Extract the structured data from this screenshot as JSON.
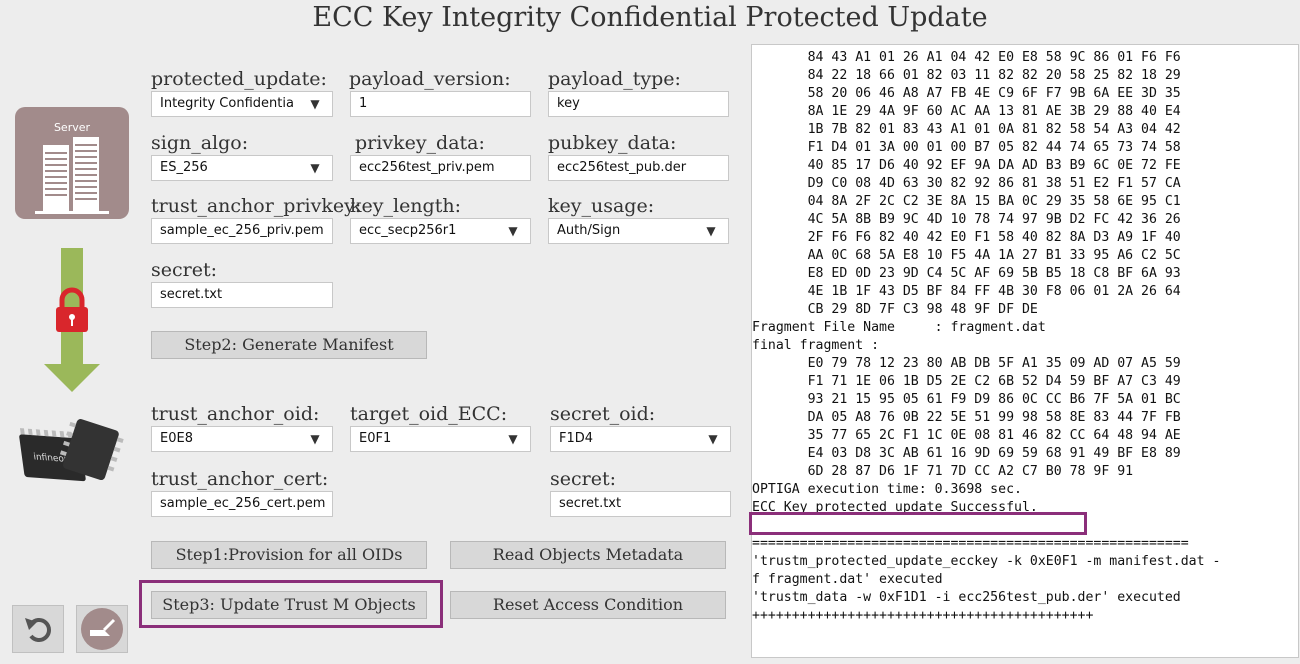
{
  "title": "ECC Key Integrity Confidential Protected Update",
  "server_label": "Server",
  "chip_brand": "infineon",
  "form": {
    "protected_update": {
      "label": "protected_update:",
      "value": "Integrity Confidentia"
    },
    "payload_version": {
      "label": "payload_version:",
      "value": "1"
    },
    "payload_type": {
      "label": "payload_type:",
      "value": "key"
    },
    "sign_algo": {
      "label": "sign_algo:",
      "value": "ES_256"
    },
    "privkey_data": {
      "label": "privkey_data:",
      "value": "ecc256test_priv.pem"
    },
    "pubkey_data": {
      "label": "pubkey_data:",
      "value": "ecc256test_pub.der"
    },
    "trust_anchor_privkey": {
      "label": "trust_anchor_privkey:",
      "value": "sample_ec_256_priv.pem"
    },
    "key_length": {
      "label": "key_length:",
      "value": "ecc_secp256r1"
    },
    "key_usage": {
      "label": "key_usage:",
      "value": "Auth/Sign"
    },
    "secret1": {
      "label": "secret:",
      "value": "secret.txt"
    },
    "trust_anchor_oid": {
      "label": "trust_anchor_oid:",
      "value": "E0E8"
    },
    "target_oid_ecc": {
      "label": "target_oid_ECC:",
      "value": "E0F1"
    },
    "secret_oid": {
      "label": "secret_oid:",
      "value": "F1D4"
    },
    "trust_anchor_cert": {
      "label": "trust_anchor_cert:",
      "value": "sample_ec_256_cert.pem"
    },
    "secret2": {
      "label": "secret:",
      "value": "secret.txt"
    }
  },
  "buttons": {
    "step2": "Step2: Generate Manifest",
    "step1": "Step1:Provision for all OIDs",
    "read_meta": "Read Objects Metadata",
    "step3": "Step3: Update Trust M Objects",
    "reset_access": "Reset Access Condition"
  },
  "console_lines": [
    "       84 43 A1 01 26 A1 04 42 E0 E8 58 9C 86 01 F6 F6",
    "       84 22 18 66 01 82 03 11 82 82 20 58 25 82 18 29",
    "       58 20 06 46 A8 A7 FB 4E C9 6F F7 9B 6A EE 3D 35",
    "       8A 1E 29 4A 9F 60 AC AA 13 81 AE 3B 29 88 40 E4",
    "       1B 7B 82 01 83 43 A1 01 0A 81 82 58 54 A3 04 42",
    "       F1 D4 01 3A 00 01 00 B7 05 82 44 74 65 73 74 58",
    "       40 85 17 D6 40 92 EF 9A DA AD B3 B9 6C 0E 72 FE",
    "       D9 C0 08 4D 63 30 82 92 86 81 38 51 E2 F1 57 CA",
    "       04 8A 2F 2C C2 3E 8A 15 BA 0C 29 35 58 6E 95 C1",
    "       4C 5A 8B B9 9C 4D 10 78 74 97 9B D2 FC 42 36 26",
    "       2F F6 F6 82 40 42 E0 F1 58 40 82 8A D3 A9 1F 40",
    "       AA 0C 68 5A E8 10 F5 4A 1A 27 B1 33 95 A6 C2 5C",
    "       E8 ED 0D 23 9D C4 5C AF 69 5B B5 18 C8 BF 6A 93",
    "       4E 1B 1F 43 D5 BF 84 FF 4B 30 F8 06 01 2A 26 64",
    "       CB 29 8D 7F C3 98 48 9F DF DE",
    "Fragment File Name     : fragment.dat",
    "final fragment :",
    "       E0 79 78 12 23 80 AB DB 5F A1 35 09 AD 07 A5 59",
    "       F1 71 1E 06 1B D5 2E C2 6B 52 D4 59 BF A7 C3 49",
    "       93 21 15 95 05 61 F9 D9 86 0C CC B6 7F 5A 01 BC",
    "       DA 05 A8 76 0B 22 5E 51 99 98 58 8E 83 44 7F FB",
    "       35 77 65 2C F1 1C 0E 08 81 46 82 CC 64 48 94 AE",
    "       E4 03 D8 3C AB 61 16 9D 69 59 68 91 49 BF E8 89",
    "       6D 28 87 D6 1F 71 7D CC A2 C7 B0 78 9F 91",
    "OPTIGA execution time: 0.3698 sec.",
    "ECC Key protected update Successful.",
    "",
    "=======================================================",
    "'trustm_protected_update_ecckey -k 0xE0F1 -m manifest.dat -",
    "f fragment.dat' executed",
    "'trustm_data -w 0xF1D1 -i ecc256test_pub.der' executed",
    "+++++++++++++++++++++++++++++++++++++++++++"
  ]
}
